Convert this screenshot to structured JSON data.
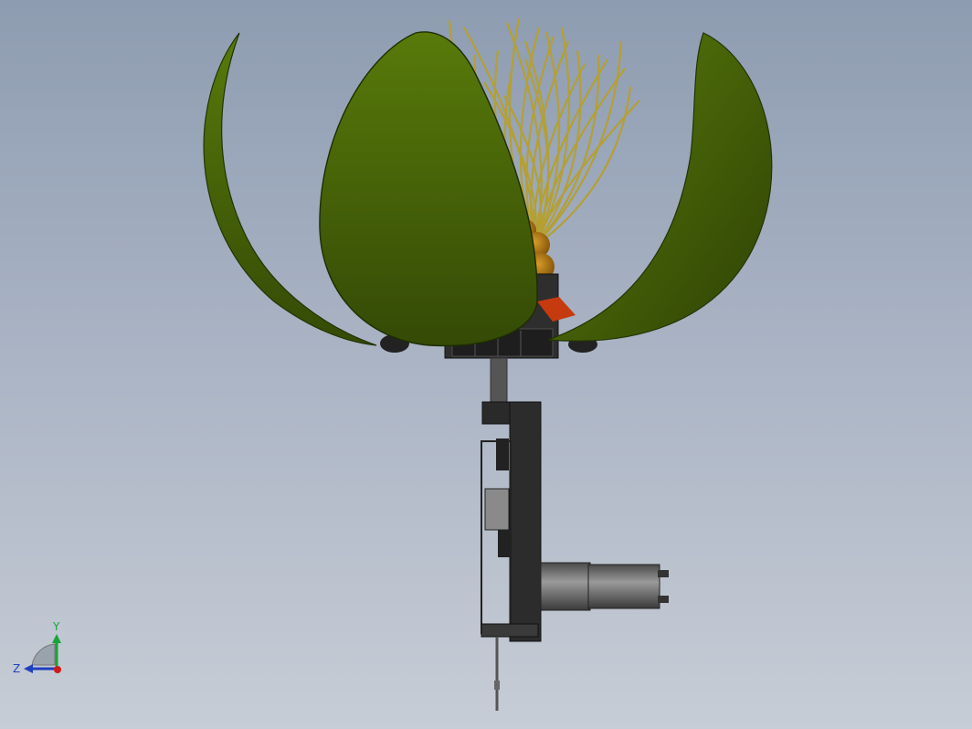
{
  "viewport": {
    "background_top": "#8e9cb1",
    "background_bottom": "#c7cdd6"
  },
  "model": {
    "petal_color": "#4f6a0a",
    "petal_dark": "#2f4205",
    "stamen_color": "#b4a033",
    "core_color": "#b07a18",
    "mechanism_color": "#3a3a3a",
    "accent_red": "#c63a10"
  },
  "triad": {
    "y_label": "Y",
    "z_label": "Z",
    "y_color": "#1aa33a",
    "z_color": "#1f3fbf",
    "x_color": "#d01a1a"
  }
}
